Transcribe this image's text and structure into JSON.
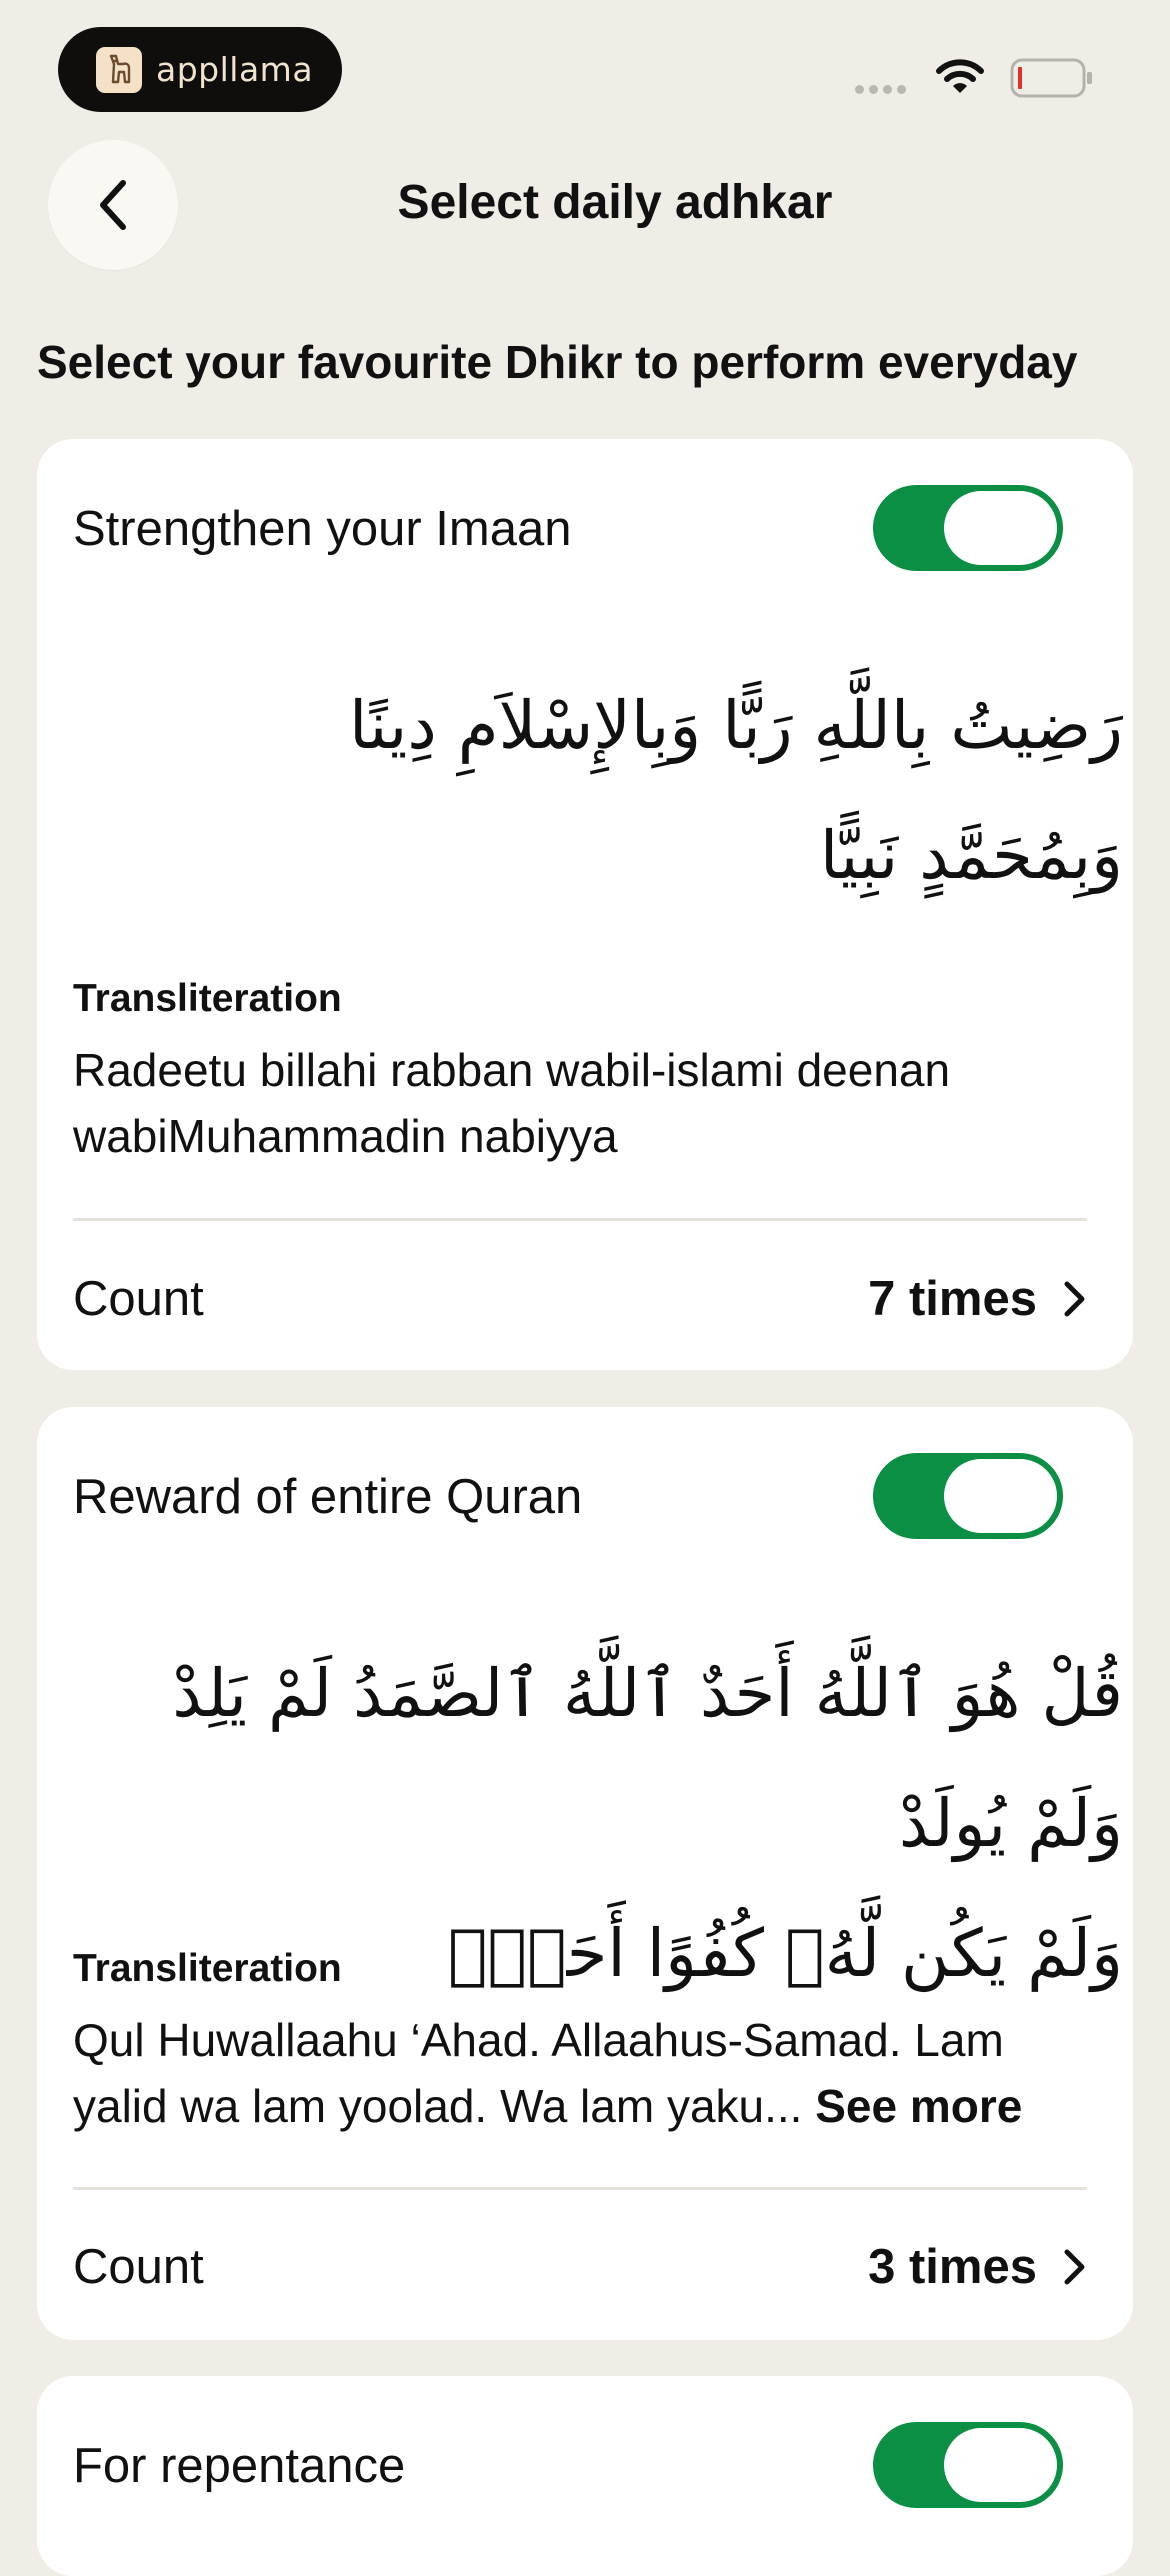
{
  "status_bar": {
    "brand_name": "appllama",
    "icons": [
      "signal-dots-icon",
      "wifi-icon",
      "battery-icon"
    ]
  },
  "header": {
    "back_icon": "chevron-left-icon",
    "title": "Select daily adhkar"
  },
  "subtitle": "Select your favourite Dhikr to perform everyday",
  "colors": {
    "background": "#F0EDE6",
    "card": "#FFFFFF",
    "toggle_on": "#0A8F45",
    "text": "#111111"
  },
  "cards": [
    {
      "title": "Strengthen your Imaan",
      "enabled": true,
      "arabic_line1": "رَضِيتُ بِاللَّهِ رَبًّا وَبِالإِسْلاَمِ دِينًا",
      "arabic_line2": "وَبِمُحَمَّدٍ نَبِيًّا",
      "translit_label": "Transliteration",
      "translit_text": "Radeetu billahi rabban wabil-islami deenan wabiMuhammadin nabiyya",
      "see_more": "",
      "count_label": "Count",
      "count_value": "7 times"
    },
    {
      "title": "Reward of entire Quran",
      "enabled": true,
      "arabic_line1": "قُلْ هُوَ ٱللَّهُ أَحَدٌ ٱللَّهُ ٱلصَّمَدُ لَمْ يَلِدْ وَلَمْ يُولَدْ",
      "arabic_line2": "وَلَمْ يَكُن لَّهُۥ كُفُوًا أَحَدٌۢ",
      "translit_label": "Transliteration",
      "translit_text": "Qul Huwallaahu ‘Ahad. Allaahus-Samad. Lam yalid wa lam yoolad. Wa lam yaku...",
      "see_more": "See more",
      "count_label": "Count",
      "count_value": "3 times"
    },
    {
      "title": "For repentance",
      "enabled": true
    }
  ]
}
